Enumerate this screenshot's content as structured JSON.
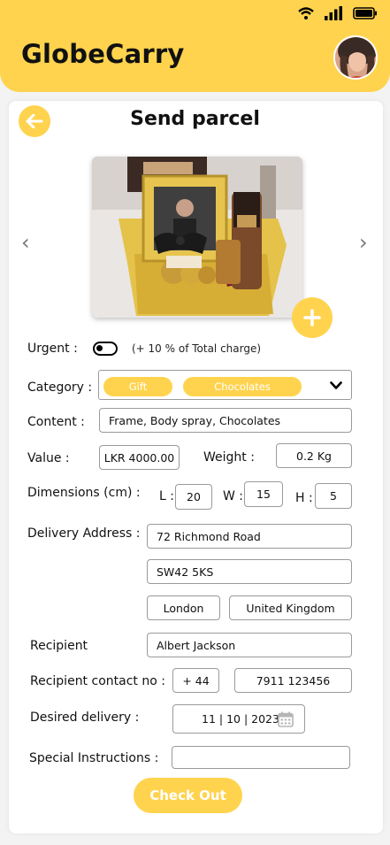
{
  "app": {
    "brand": "GlobeCarry"
  },
  "page": {
    "title": "Send parcel"
  },
  "colors": {
    "accent": "#ffd34e",
    "card": "#ffffff",
    "text": "#111111"
  },
  "icons": {
    "status": [
      "wifi-icon",
      "signal-icon",
      "battery-icon"
    ],
    "back": "arrow-left-icon",
    "prev": "chevron-left-icon",
    "next": "chevron-right-icon",
    "add": "plus-icon",
    "dropdown": "chevron-down-icon",
    "calendar": "calendar-icon"
  },
  "form": {
    "urgent": {
      "label": "Urgent :",
      "note": "(+ 10 % of Total charge)",
      "enabled": false
    },
    "category": {
      "label": "Category :",
      "chips": [
        "Gift",
        "Chocolates"
      ]
    },
    "content": {
      "label": "Content :",
      "value": "Frame, Body spray, Chocolates"
    },
    "value": {
      "label": "Value :",
      "value": "LKR 4000.00"
    },
    "weight": {
      "label": "Weight :",
      "value": "0.2 Kg"
    },
    "dimensions": {
      "label": "Dimensions (cm) :",
      "l_label": "L :",
      "l": "20",
      "w_label": "W :",
      "w": "15",
      "h_label": "H :",
      "h": "5"
    },
    "address": {
      "label": "Delivery Address :",
      "line1": "72 Richmond Road",
      "line2": "SW42 5KS",
      "city": "London",
      "country": "United Kingdom"
    },
    "recipient": {
      "label": "Recipient",
      "value": "Albert Jackson"
    },
    "contact": {
      "label": "Recipient contact no :",
      "code": "+ 44",
      "number": "7911 123456"
    },
    "delivery": {
      "label": "Desired delivery :",
      "date": "11 | 10 | 2023"
    },
    "instructions": {
      "label": "Special Instructions :",
      "value": ""
    }
  },
  "actions": {
    "checkout": "Check Out"
  }
}
